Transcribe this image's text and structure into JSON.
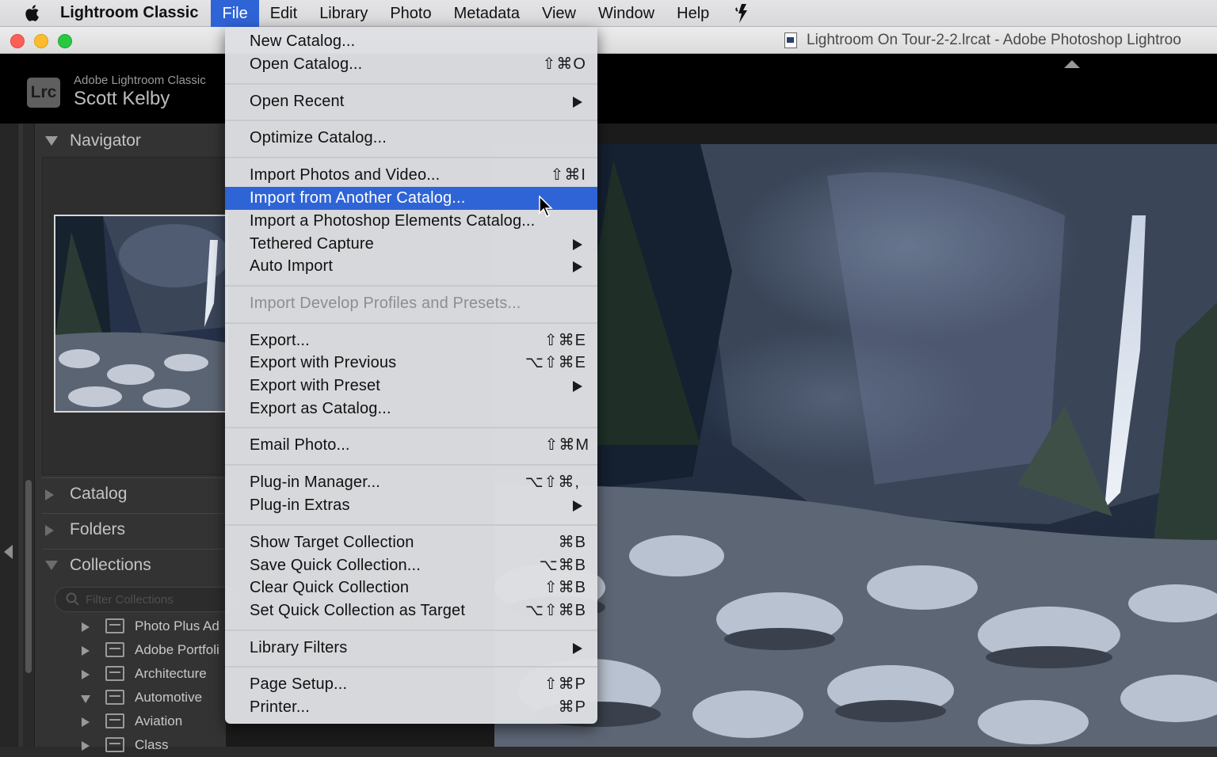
{
  "menubar": {
    "app_name": "Lightroom Classic",
    "items": [
      "File",
      "Edit",
      "Library",
      "Photo",
      "Metadata",
      "View",
      "Window",
      "Help"
    ],
    "active": "File"
  },
  "window": {
    "title": "Lightroom On Tour-2-2.lrcat - Adobe Photoshop Lightroo"
  },
  "identity": {
    "badge": "Lrc",
    "line1": "Adobe Lightroom Classic",
    "line2": "Scott Kelby"
  },
  "left_panel": {
    "navigator": "Navigator",
    "catalog": "Catalog",
    "folders": "Folders",
    "collections": "Collections",
    "filter_placeholder": "Filter Collections",
    "collection_items": [
      {
        "label": "Photo Plus Ad",
        "expanded": false
      },
      {
        "label": "Adobe Portfoli",
        "expanded": false
      },
      {
        "label": "Architecture",
        "expanded": false
      },
      {
        "label": "Automotive",
        "expanded": true
      },
      {
        "label": "Aviation",
        "expanded": false
      },
      {
        "label": "Class",
        "expanded": false
      }
    ]
  },
  "file_menu": {
    "items": [
      {
        "label": "New Catalog...",
        "shortcut": ""
      },
      {
        "label": "Open Catalog...",
        "shortcut": "⇧⌘O"
      },
      {
        "label": "Open Recent",
        "submenu": true
      },
      {
        "label": "Optimize Catalog...",
        "shortcut": ""
      },
      {
        "label": "Import Photos and Video...",
        "shortcut": "⇧⌘I"
      },
      {
        "label": "Import from Another Catalog...",
        "highlighted": true
      },
      {
        "label": "Import a Photoshop Elements Catalog..."
      },
      {
        "label": "Tethered Capture",
        "submenu": true
      },
      {
        "label": "Auto Import",
        "submenu": true
      },
      {
        "label": "Import Develop Profiles and Presets...",
        "disabled": true
      },
      {
        "label": "Export...",
        "shortcut": "⇧⌘E"
      },
      {
        "label": "Export with Previous",
        "shortcut": "⌥⇧⌘E"
      },
      {
        "label": "Export with Preset",
        "submenu": true
      },
      {
        "label": "Export as Catalog..."
      },
      {
        "label": "Email Photo...",
        "shortcut": "⇧⌘M"
      },
      {
        "label": "Plug-in Manager...",
        "shortcut": "⌥⇧⌘,"
      },
      {
        "label": "Plug-in Extras",
        "submenu": true
      },
      {
        "label": "Show Target Collection",
        "shortcut": "⌘B"
      },
      {
        "label": "Save Quick Collection...",
        "shortcut": "⌥⌘B"
      },
      {
        "label": "Clear Quick Collection",
        "shortcut": "⇧⌘B"
      },
      {
        "label": "Set Quick Collection as Target",
        "shortcut": "⌥⇧⌘B"
      },
      {
        "label": "Library Filters",
        "submenu": true
      },
      {
        "label": "Page Setup...",
        "shortcut": "⇧⌘P"
      },
      {
        "label": "Printer...",
        "shortcut": "⌘P"
      }
    ]
  },
  "colors": {
    "menu_highlight": "#2f64d6",
    "panel_bg": "#333333",
    "identity_bg": "#000000"
  },
  "icons": [
    "apple-icon",
    "script-icon",
    "document-icon",
    "search-icon",
    "collection-set-icon",
    "mouse-pointer-icon"
  ]
}
